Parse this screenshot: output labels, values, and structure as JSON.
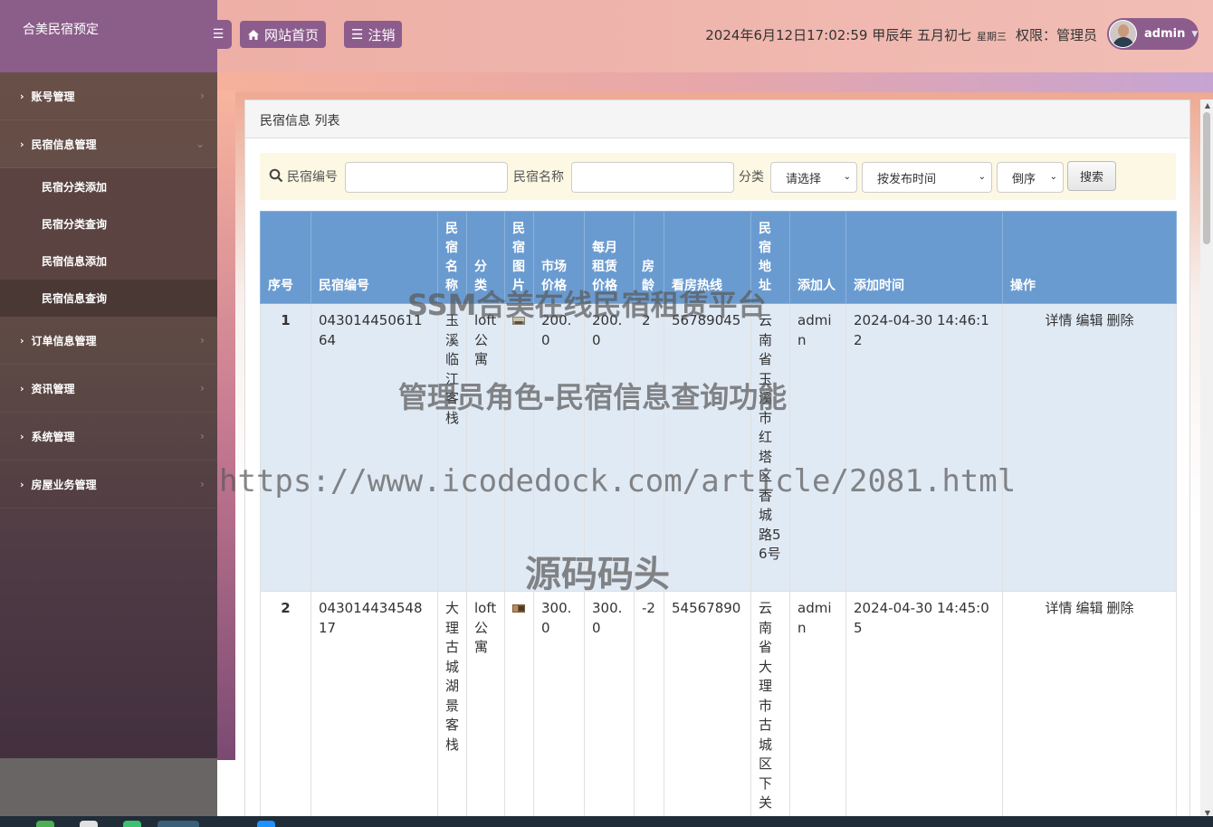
{
  "brand": "合美民宿预定",
  "sidebar": {
    "items": [
      {
        "label": "账号管理"
      },
      {
        "label": "民宿信息管理"
      },
      {
        "label": "订单信息管理"
      },
      {
        "label": "资讯管理"
      },
      {
        "label": "系统管理"
      },
      {
        "label": "房屋业务管理"
      }
    ],
    "submenu": [
      {
        "label": "民宿分类添加"
      },
      {
        "label": "民宿分类查询"
      },
      {
        "label": "民宿信息添加"
      },
      {
        "label": "民宿信息查询"
      }
    ]
  },
  "topbar": {
    "home_label": "网站首页",
    "logout_label": "注销",
    "datetime": "2024年6月12日17:02:59 甲辰年 五月初七",
    "weekday": "星期三",
    "role": "权限：管理员",
    "username": "admin"
  },
  "panel": {
    "title": "民宿信息 列表"
  },
  "search": {
    "code_label": "民宿编号",
    "name_label": "民宿名称",
    "category_label": "分类",
    "category_value": "请选择",
    "sort_value": "按发布时间",
    "order_value": "倒序",
    "button_label": "搜索"
  },
  "table": {
    "headers": [
      "序号",
      "民宿编号",
      "民宿名称",
      "分类",
      "民宿图片",
      "市场价格",
      "每月租赁价格",
      "房龄",
      "看房热线",
      "民宿地址",
      "添加人",
      "添加时间",
      "操作"
    ],
    "rows": [
      {
        "no": "1",
        "code": "04301445061164",
        "name": "玉溪临江客栈",
        "category": "loft公寓",
        "market_price": "200.0",
        "monthly_price": "200.0",
        "age": "2",
        "hotline": "56789045",
        "address": "云南省玉溪市红塔区香城路56号",
        "added_by": "admin",
        "added_time": "2024-04-30 14:46:12"
      },
      {
        "no": "2",
        "code": "04301443454817",
        "name": "大理古城湖景客栈",
        "category": "loft公寓",
        "market_price": "300.0",
        "monthly_price": "300.0",
        "age": "-2",
        "hotline": "54567890",
        "address": "云南省大理市古城区下关",
        "added_by": "admin",
        "added_time": "2024-04-30 14:45:05"
      }
    ],
    "ops": {
      "detail": "详情",
      "edit": "编辑",
      "delete": "删除"
    }
  },
  "watermarks": {
    "line1": "SSM合美在线民宿租赁平台",
    "line2": "管理员角色-民宿信息查询功能",
    "line3": "https://www.icodedock.com/article/2081.html",
    "line4": "源码码头"
  },
  "colors": {
    "accent": "#8c5d8c",
    "table_header": "#6a9bd0",
    "search_bg": "#fcf8e3"
  }
}
